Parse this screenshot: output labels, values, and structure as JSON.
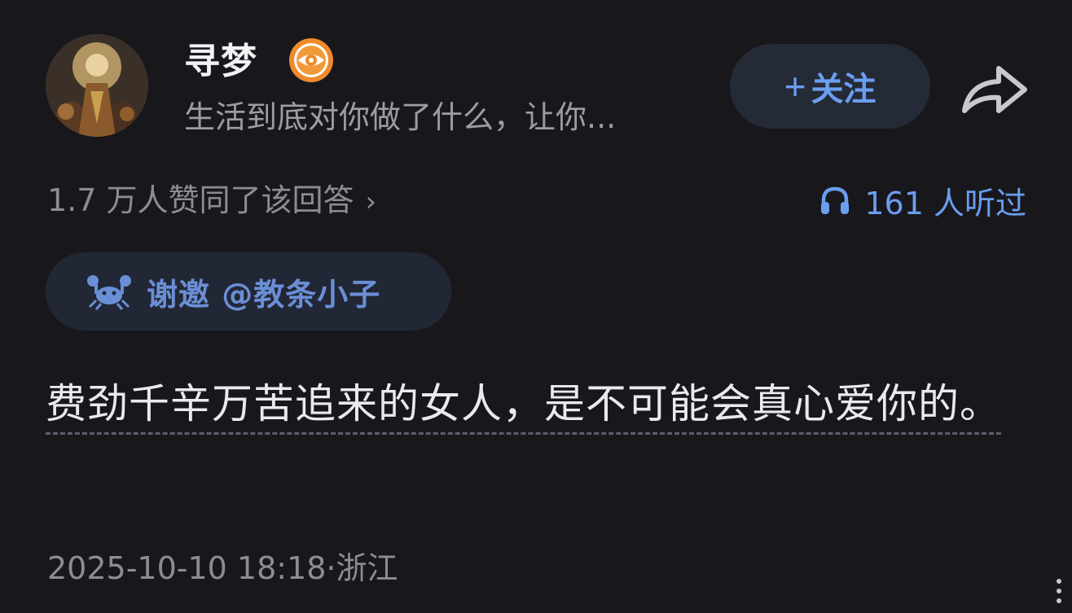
{
  "author": {
    "name": "寻梦",
    "bio": "生活到底对你做了什么，让你..."
  },
  "actions": {
    "follow_plus": "+",
    "follow_label": "关注"
  },
  "stats": {
    "upvotes": "1.7 万人赞同了该回答",
    "upvotes_chevron": "›",
    "listens": "161 人听过"
  },
  "invite": {
    "label": "谢邀 @教条小子"
  },
  "answer": {
    "text": "费劲千辛万苦追来的女人，是不可能会真心爱你的。"
  },
  "meta": {
    "timestamp": "2025-10-10 18:18·浙江"
  },
  "colors": {
    "background": "#18181c",
    "accent": "#6a9eef",
    "chip_bg": "#222735",
    "muted_text": "#8c8c96",
    "badge_orange": "#f08a2a"
  },
  "icons": {
    "badge": "eye-badge-icon",
    "share": "share-arrow-icon",
    "listen": "headphones-icon",
    "invite": "crab-icon"
  }
}
